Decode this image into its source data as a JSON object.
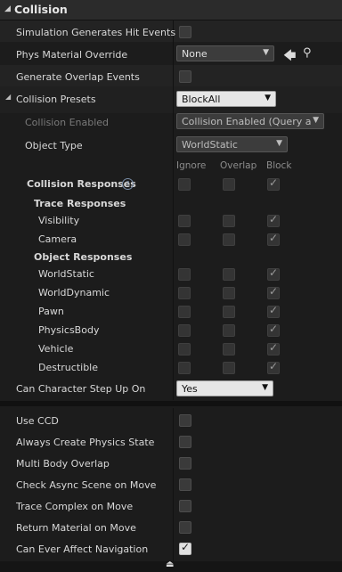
{
  "section": {
    "title": "Collision"
  },
  "props": {
    "sim_hit_events": "Simulation Generates Hit Events",
    "phys_material_override": "Phys Material Override",
    "phys_material_value": "None",
    "generate_overlap_events": "Generate Overlap Events",
    "collision_presets": "Collision Presets",
    "collision_presets_value": "BlockAll",
    "collision_enabled": "Collision Enabled",
    "collision_enabled_value": "Collision Enabled (Query and",
    "object_type": "Object Type",
    "object_type_value": "WorldStatic",
    "collision_responses": "Collision Responses",
    "trace_responses": "Trace Responses",
    "object_responses": "Object Responses",
    "can_step_up": "Can Character Step Up On",
    "can_step_up_value": "Yes"
  },
  "columns": {
    "ignore": "Ignore",
    "overlap": "Overlap",
    "block": "Block"
  },
  "trace_channels": [
    "Visibility",
    "Camera"
  ],
  "object_channels": [
    "WorldStatic",
    "WorldDynamic",
    "Pawn",
    "PhysicsBody",
    "Vehicle",
    "Destructible"
  ],
  "advanced": {
    "use_ccd": "Use CCD",
    "always_create_physics_state": "Always Create Physics State",
    "multi_body_overlap": "Multi Body Overlap",
    "check_async_scene": "Check Async Scene on Move",
    "trace_complex": "Trace Complex on Move",
    "return_material": "Return Material on Move",
    "can_affect_navigation": "Can Ever Affect Navigation"
  },
  "icons": {
    "collapse": "triangle-down-icon",
    "use_selected": "arrow-left-icon",
    "browse": "magnifier-icon",
    "help": "question-icon",
    "expand_advanced": "chevron-up-icon"
  }
}
